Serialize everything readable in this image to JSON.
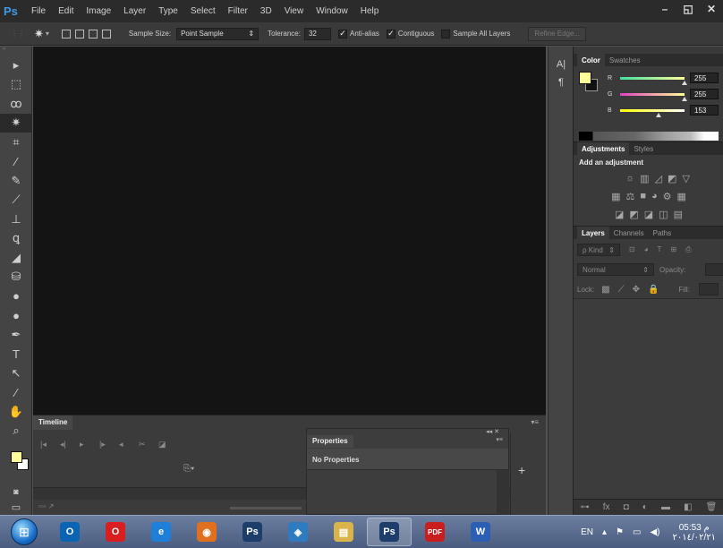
{
  "menubar": {
    "logo": "Ps",
    "items": [
      "File",
      "Edit",
      "Image",
      "Layer",
      "Type",
      "Select",
      "Filter",
      "3D",
      "View",
      "Window",
      "Help"
    ],
    "window_controls": [
      "–",
      "◱",
      "✕"
    ]
  },
  "options": {
    "sample_size_label": "Sample Size:",
    "sample_size_value": "Point Sample",
    "tolerance_label": "Tolerance:",
    "tolerance_value": "32",
    "anti_alias_label": "Anti-alias",
    "anti_alias_checked": true,
    "contiguous_label": "Contiguous",
    "contiguous_checked": true,
    "sample_all_layers_label": "Sample All Layers",
    "sample_all_layers_checked": false,
    "refine_edge_label": "Refine Edge..."
  },
  "tools": [
    {
      "name": "move-tool",
      "glyph": "▸"
    },
    {
      "name": "marquee-tool",
      "glyph": "⬚"
    },
    {
      "name": "lasso-tool",
      "glyph": "ꝏ"
    },
    {
      "name": "magic-wand-tool",
      "glyph": "✷"
    },
    {
      "name": "crop-tool",
      "glyph": "⌗"
    },
    {
      "name": "eyedropper-tool",
      "glyph": "⁄"
    },
    {
      "name": "healing-brush-tool",
      "glyph": "✎"
    },
    {
      "name": "brush-tool",
      "glyph": "⟋"
    },
    {
      "name": "clone-stamp-tool",
      "glyph": "⊥"
    },
    {
      "name": "history-brush-tool",
      "glyph": "ꝗ"
    },
    {
      "name": "eraser-tool",
      "glyph": "◢"
    },
    {
      "name": "paint-bucket-tool",
      "glyph": "⛁"
    },
    {
      "name": "blur-tool",
      "glyph": "●"
    },
    {
      "name": "dodge-tool",
      "glyph": "●"
    },
    {
      "name": "pen-tool",
      "glyph": "✒"
    },
    {
      "name": "type-tool",
      "glyph": "T"
    },
    {
      "name": "path-selection-tool",
      "glyph": "↖"
    },
    {
      "name": "shape-tool",
      "glyph": "∕"
    },
    {
      "name": "hand-tool",
      "glyph": "✋"
    },
    {
      "name": "zoom-tool",
      "glyph": "⌕"
    }
  ],
  "timeline": {
    "tab": "Timeline",
    "controls": [
      "|◂",
      "◂|",
      "▸",
      "|▸",
      "◂",
      "✂",
      "◪"
    ]
  },
  "properties": {
    "tab": "Properties",
    "body": "No Properties",
    "add_button": "+"
  },
  "strip_icons": [
    "A|",
    "¶"
  ],
  "color_panel": {
    "tabs": [
      "Color",
      "Swatches"
    ],
    "foreground": "#ffff99",
    "background": "#111111",
    "r_label": "R",
    "r_value": "255",
    "g_label": "G",
    "g_value": "255",
    "b_label": "B",
    "b_value": "153"
  },
  "adjustments_panel": {
    "tabs": [
      "Adjustments",
      "Styles"
    ],
    "title": "Add an adjustment",
    "row1": [
      "☼",
      "▥",
      "◿",
      "◩",
      "▽"
    ],
    "row2": [
      "▦",
      "⚖",
      "■",
      "◕",
      "⚙",
      "▦"
    ],
    "row3": [
      "◪",
      "◩",
      "◪",
      "◫",
      "▤"
    ]
  },
  "layers_panel": {
    "tabs": [
      "Layers",
      "Channels",
      "Paths"
    ],
    "kind_label": "ρ Kind",
    "filter_icons": [
      "⊡",
      "◕",
      "T",
      "⊞",
      "⎙"
    ],
    "blend_mode": "Normal",
    "opacity_label": "Opacity:",
    "lock_label": "Lock:",
    "lock_icons": [
      "▩",
      "⟋",
      "✥",
      "🔒"
    ],
    "fill_label": "Fill:",
    "bottom_icons": [
      "⊶",
      "fx",
      "◘",
      "◐",
      "▬",
      "◧",
      "🗑"
    ]
  },
  "taskbar": {
    "apps": [
      {
        "name": "outlook",
        "label": "O",
        "color": "#0a64b4"
      },
      {
        "name": "opera",
        "label": "O",
        "color": "#d81e1e"
      },
      {
        "name": "internet-explorer",
        "label": "e",
        "color": "#1e7fd8"
      },
      {
        "name": "firefox",
        "label": "◉",
        "color": "#e0701e"
      },
      {
        "name": "photoshop",
        "label": "Ps",
        "color": "#1d3d6b"
      },
      {
        "name": "network",
        "label": "◈",
        "color": "#2f7bc0"
      },
      {
        "name": "file-explorer",
        "label": "▤",
        "color": "#d9b449"
      },
      {
        "name": "photoshop-2",
        "label": "Ps",
        "color": "#1d3d6b"
      },
      {
        "name": "pdf",
        "label": "PDF",
        "color": "#c81e1e"
      },
      {
        "name": "word",
        "label": "W",
        "color": "#2b5fb3"
      }
    ],
    "language": "EN",
    "tray_icons": [
      "▴",
      "⚑",
      "▭",
      "◀)"
    ],
    "time": "05:53 م",
    "date": "٢٠١٤/٠٢/٢١"
  }
}
